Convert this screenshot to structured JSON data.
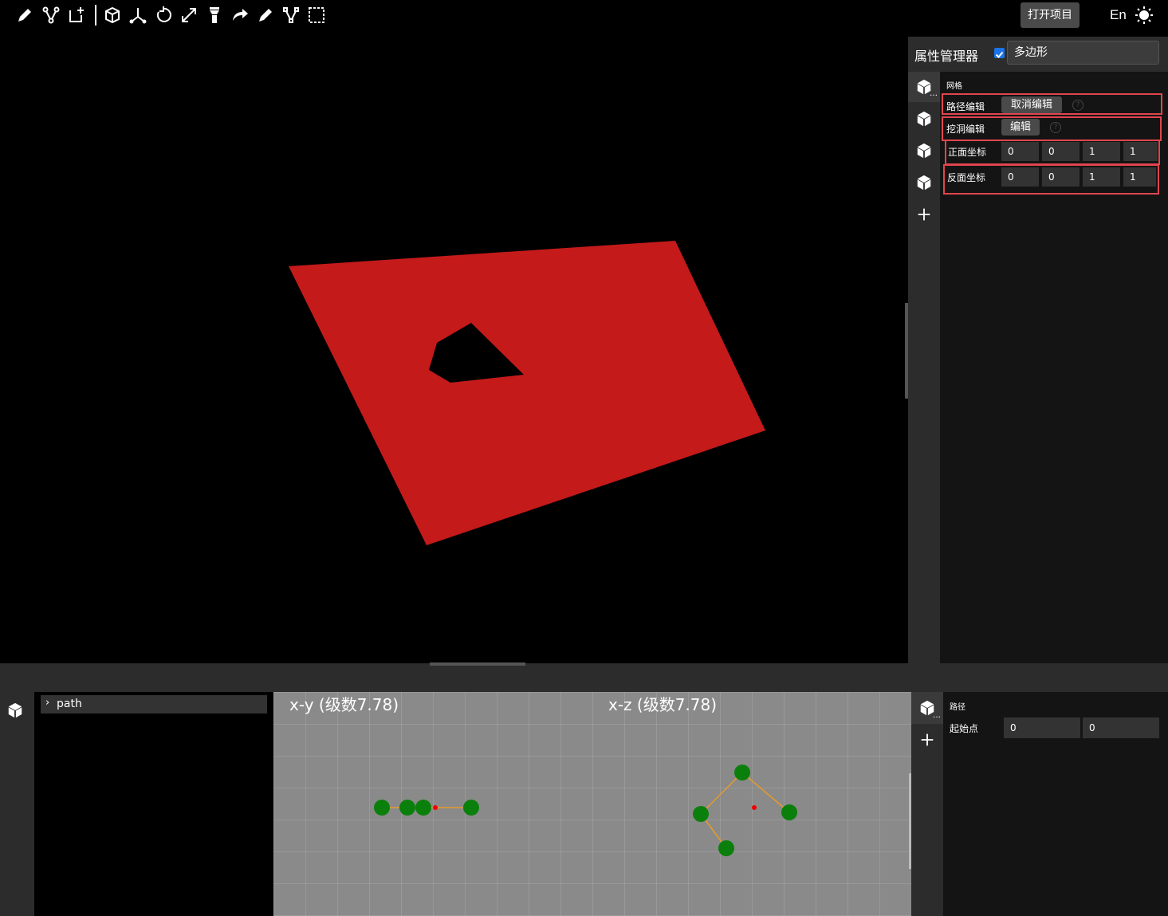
{
  "toolbar": {
    "left_icons": [
      "pencil-icon",
      "path-edit-icon",
      "add-shape-icon",
      "cube-icon",
      "axes-icon",
      "rotate-icon",
      "scale-icon",
      "flashlight-icon",
      "redo-arrow-icon",
      "pencil-icon",
      "path-node-icon",
      "selection-box-icon"
    ],
    "open_project_label": "打开项目",
    "language_label": "En"
  },
  "property_manager": {
    "title": "属性管理器",
    "enabled": true,
    "object_name": "多边形",
    "section_label": "网格",
    "path_edit": {
      "label": "路径编辑",
      "button": "取消编辑"
    },
    "hole_edit": {
      "label": "挖洞编辑",
      "button": "编辑"
    },
    "front_coords": {
      "label": "正面坐标",
      "values": [
        "0",
        "0",
        "1",
        "1"
      ]
    },
    "back_coords": {
      "label": "反面坐标",
      "values": [
        "0",
        "0",
        "1",
        "1"
      ]
    }
  },
  "bottom": {
    "tree_item": "path",
    "view_xy_title": "x-y (级数7.78)",
    "view_xz_title": "x-z (级数7.78)",
    "path_section_label": "路径",
    "start_point_label": "起始点",
    "start_point_values": [
      "0",
      "0"
    ]
  },
  "colors": {
    "polygon_fill": "#c41a1a",
    "node_green": "#0b7f0b",
    "edge_orange": "#e59b2b",
    "highlight_red": "#e0454e"
  }
}
